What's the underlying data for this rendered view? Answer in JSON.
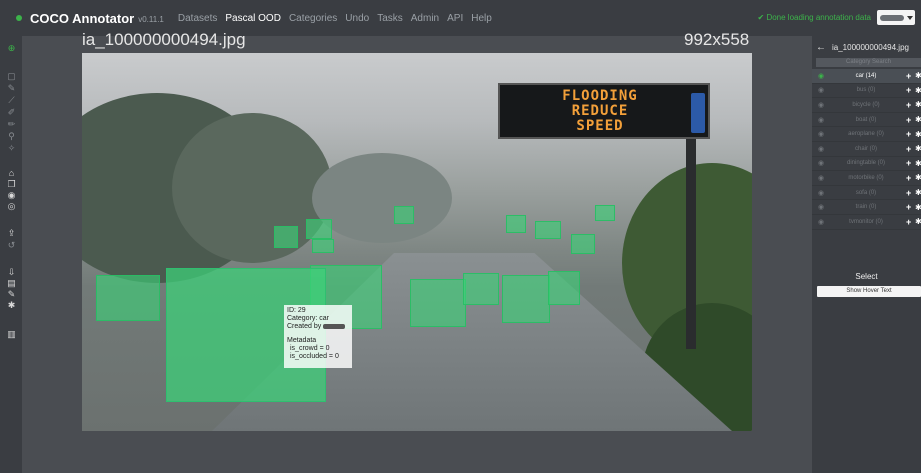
{
  "navbar": {
    "brand": "COCO Annotator",
    "version": "v0.11.1",
    "items": [
      {
        "label": "Datasets",
        "active": false
      },
      {
        "label": "Pascal OOD",
        "active": true
      },
      {
        "label": "Categories",
        "active": false
      },
      {
        "label": "Undo",
        "active": false
      },
      {
        "label": "Tasks",
        "active": false
      },
      {
        "label": "Admin",
        "active": false
      },
      {
        "label": "API",
        "active": false
      },
      {
        "label": "Help",
        "active": false
      }
    ],
    "status": "✔ Done loading annotation data"
  },
  "canvas": {
    "file_name": "ia_100000000494.jpg",
    "dimensions": "992x558",
    "sign_lines": [
      "FLOODING",
      "REDUCE",
      "SPEED"
    ],
    "tooltip": {
      "id_line": "ID: 29",
      "category_line": "Category: car",
      "created_by": "Created by",
      "metadata": "Metadata",
      "is_crowd": "is_crowd = 0",
      "is_occluded": "is_occluded = 0"
    }
  },
  "sidebar": {
    "back": "←",
    "file_name": "ia_100000000494.jpg",
    "search_placeholder": "Category Search",
    "categories": [
      {
        "label": "car (14)",
        "active": true
      },
      {
        "label": "bus (0)",
        "active": false
      },
      {
        "label": "bicycle (0)",
        "active": false
      },
      {
        "label": "boat (0)",
        "active": false
      },
      {
        "label": "aeroplane (0)",
        "active": false
      },
      {
        "label": "chair (0)",
        "active": false
      },
      {
        "label": "diningtable (0)",
        "active": false
      },
      {
        "label": "motorbike (0)",
        "active": false
      },
      {
        "label": "sofa (0)",
        "active": false
      },
      {
        "label": "train (0)",
        "active": false
      },
      {
        "label": "tvmonitor (0)",
        "active": false
      }
    ],
    "mode_title": "Select",
    "hover_button": "Show Hover Text"
  },
  "colors": {
    "accent": "#3cb34a",
    "annotation": "#3cd278"
  }
}
